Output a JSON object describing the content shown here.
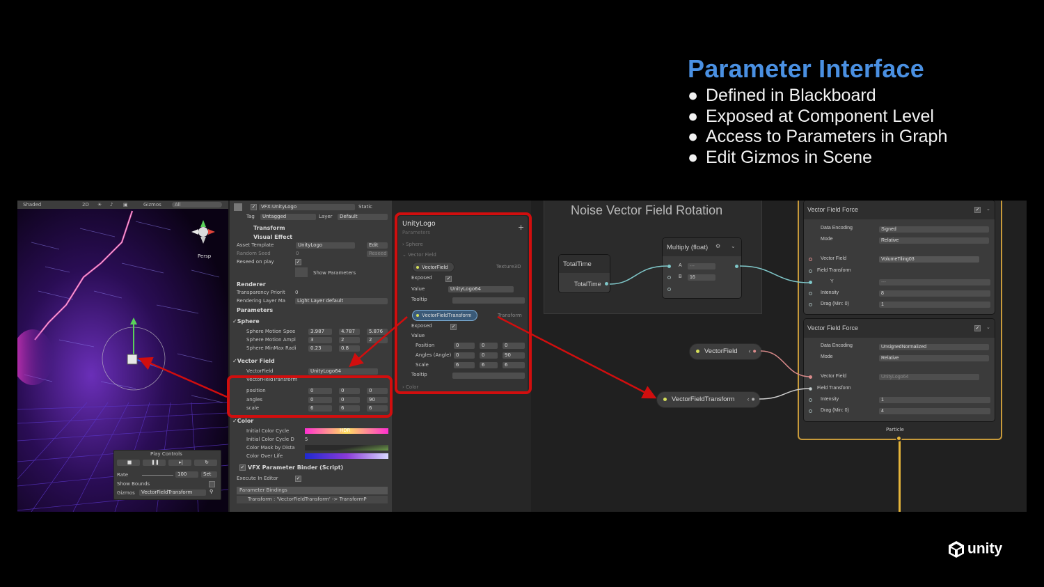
{
  "slide": {
    "title": "Parameter Interface",
    "bullets": [
      "Defined in Blackboard",
      "Exposed at Component Level",
      "Access to Parameters in Graph",
      "Edit Gizmos in Scene"
    ],
    "bullet_char": "●",
    "logo_text": "unity"
  },
  "scene": {
    "shading": "Shaded",
    "mode_2d": "2D",
    "gizmos": "Gizmos",
    "search": "All",
    "persp": "Persp",
    "play_controls": {
      "title": "Play Controls",
      "rate_label": "Rate",
      "rate_value": "100",
      "set_label": "Set",
      "show_bounds": "Show Bounds",
      "gizmos_label": "Gizmos",
      "gizmos_value": "VectorFieldTransform"
    }
  },
  "inspector": {
    "object_name": "VFX:UnityLogo",
    "static_label": "Static",
    "tag_label": "Tag",
    "tag_value": "Untagged",
    "layer_label": "Layer",
    "layer_value": "Default",
    "transform": "Transform",
    "visual_effect": "Visual Effect",
    "asset_template_label": "Asset Template",
    "asset_template_value": "UnityLogo",
    "edit_button": "Edit",
    "random_seed_label": "Random Seed",
    "random_seed_value": "0",
    "reseed_button": "Reseed",
    "reseed_on_play": "Reseed on play",
    "show_parameters": "Show Parameters",
    "renderer": "Renderer",
    "transparency_label": "Transparency Priorit",
    "transparency_value": "0",
    "rendering_layer_label": "Rendering Layer Ma",
    "rendering_layer_value": "Light Layer default",
    "parameters": "Parameters",
    "sphere": "Sphere",
    "sphere_motion_speed": "Sphere Motion Spee",
    "sms_x": "3.987",
    "sms_y": "4.787",
    "sms_z": "5.876",
    "sphere_motion_ampl": "Sphere Motion Ampl",
    "sma_x": "3",
    "sma_y": "2",
    "sma_z": "2",
    "sphere_minmax": "Sphere MinMax Radi",
    "smm_x": "0.23",
    "smm_y": "0.8",
    "vector_field": "Vector Field",
    "vector_field_label": "VectorField",
    "vector_field_value": "UnityLogo64",
    "vft": "VectorFieldTransform",
    "position": "position",
    "angles": "angles",
    "scale": "scale",
    "pos_x": "0",
    "pos_y": "0",
    "pos_z": "0",
    "ang_x": "0",
    "ang_y": "0",
    "ang_z": "90",
    "scl_x": "6",
    "scl_y": "6",
    "scl_z": "6",
    "color": "Color",
    "initial_color_cycle": "Initial Color Cycle",
    "hdr": "HDR",
    "initial_color_cycle_d": "Initial Color Cycle D",
    "initial_color_cycle_d_value": "5",
    "color_mask": "Color Mask by Dista",
    "color_over_life": "Color Over Life",
    "binder": "VFX Parameter Binder (Script)",
    "execute_in_editor": "Execute In Editor",
    "parameter_bindings": "Parameter Bindings",
    "binding_line": "Transform : 'VectorFieldTransform' -> TransformP"
  },
  "blackboard": {
    "title": "UnityLogo",
    "subtitle": "Parameters",
    "add": "+",
    "sphere": "Sphere",
    "vector_field": "Vector Field",
    "vf_param": "VectorField",
    "vf_type": "Texture3D",
    "exposed": "Exposed",
    "value": "Value",
    "vf_value": "UnityLogo64",
    "tooltip": "Tooltip",
    "vft_param": "VectorFieldTransform",
    "vft_type": "Transform",
    "position": "Position",
    "angles": "Angles (Angle)",
    "scale": "Scale",
    "p": [
      "0",
      "0",
      "0"
    ],
    "a": [
      "0",
      "0",
      "90"
    ],
    "s": [
      "6",
      "6",
      "6"
    ],
    "color": "Color"
  },
  "graph": {
    "group_title": "Noise Vector Field Rotation",
    "total_time_node": "TotalTime",
    "total_time_port": "TotalTime",
    "multiply_node": "Multiply (float)",
    "a_label": "A",
    "a_value": "---",
    "b_label": "B",
    "b_value": "16",
    "vector_field_pill": "VectorField",
    "vft_pill": "VectorFieldTransform",
    "block1": {
      "title": "Vector Field Force",
      "data_encoding_label": "Data Encoding",
      "data_encoding_value": "Signed",
      "mode_label": "Mode",
      "mode_value": "Relative",
      "vector_field_label": "Vector Field",
      "vector_field_value": "VolumeTiling03",
      "field_transform_label": "Field Transform",
      "y_label": "Y",
      "y_value": "---",
      "intensity_label": "Intensity",
      "intensity_value": "8",
      "drag_label": "Drag (Min: 0)",
      "drag_value": "1"
    },
    "block2": {
      "title": "Vector Field Force",
      "data_encoding_label": "Data Encoding",
      "data_encoding_value": "UnsignedNormalized",
      "mode_label": "Mode",
      "mode_value": "Relative",
      "vector_field_label": "Vector Field",
      "vector_field_value": "UnityLogo64",
      "field_transform_label": "Field Transform",
      "intensity_label": "Intensity",
      "intensity_value": "1",
      "drag_label": "Drag (Min: 0)",
      "drag_value": "4"
    },
    "particle": "Particle"
  },
  "colors": {
    "title_blue": "#4a90e2",
    "highlight_red": "#d10e0e",
    "context_yellow": "#e6b53a",
    "attr_cyan": "#7fc7c9",
    "attr_pink": "#d98a8a"
  }
}
